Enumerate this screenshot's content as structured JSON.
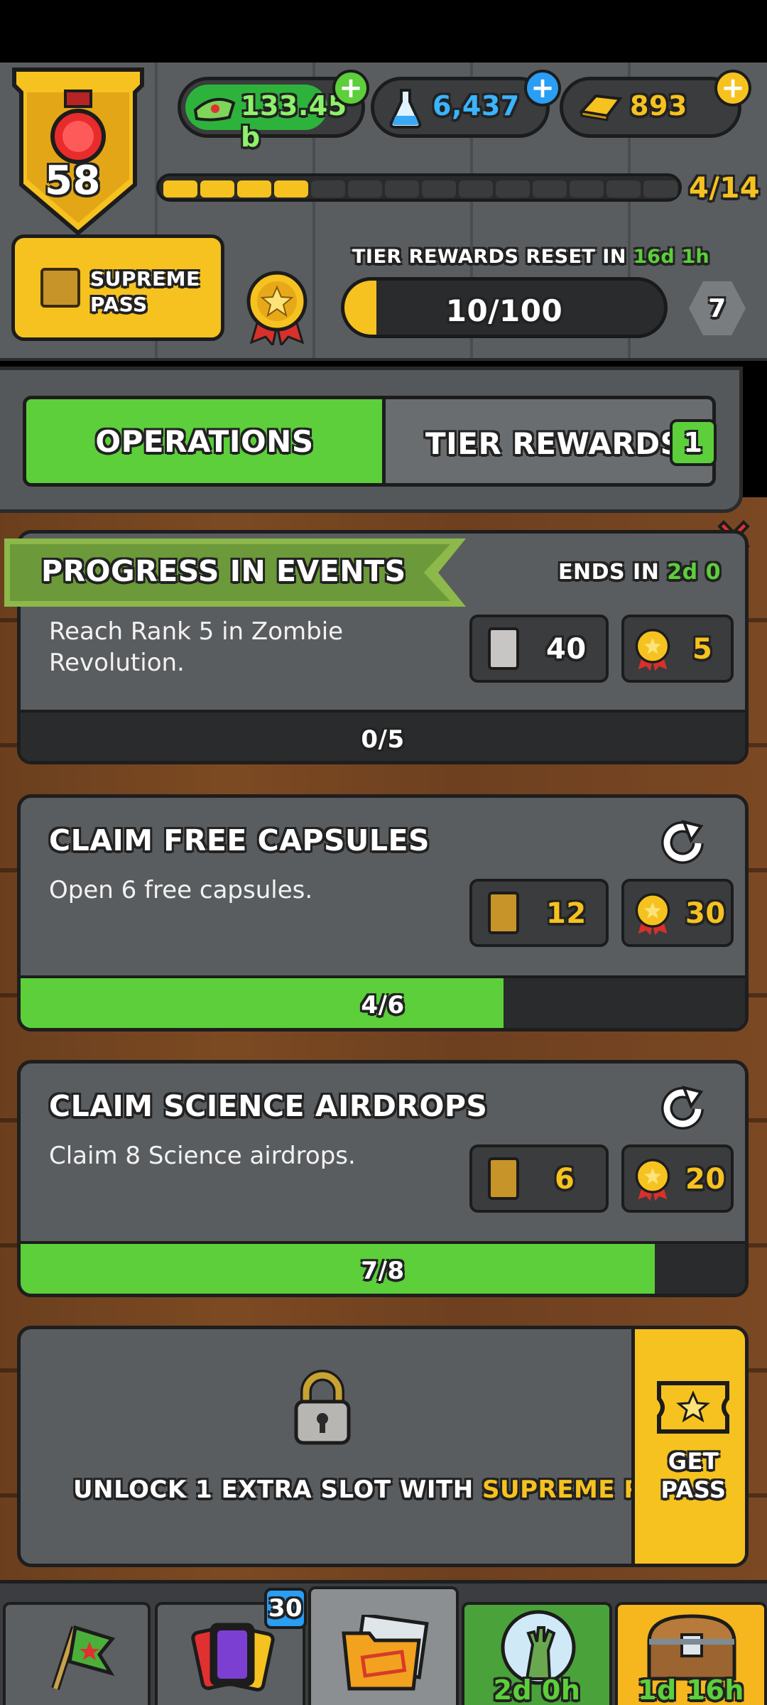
{
  "player": {
    "level": "58",
    "level_progress": "4/14",
    "level_progress_fraction": 0.286
  },
  "currencies": [
    {
      "name": "cash",
      "icon": "cash-icon",
      "value": "133.45 b",
      "plus_color": "#5ccf3b"
    },
    {
      "name": "science",
      "icon": "flask-icon",
      "value": "6,437",
      "plus_color": "#2a9df4"
    },
    {
      "name": "gold",
      "icon": "gold-bars-icon",
      "value": "893",
      "plus_color": "#f6c21f"
    }
  ],
  "supreme_pass": {
    "label_line1": "SUPREME",
    "label_line2": "PASS"
  },
  "tier": {
    "reset_label": "TIER REWARDS RESET IN",
    "reset_time": "16d 1h",
    "progress": "10/100",
    "progress_fraction": 0.1,
    "tier_number": "7"
  },
  "tabs": {
    "operations": "OPERATIONS",
    "tier_rewards": "TIER REWARDS",
    "tier_rewards_badge": "1"
  },
  "missions": [
    {
      "title": "PROGRESS IN EVENTS",
      "ends_label": "ENDS IN",
      "ends_time": "2d 0",
      "desc_line1": "Reach Rank 5 in Zombie",
      "desc_line2": "Revolution.",
      "reward_card_icon": "silver-card-icon",
      "reward_cards": "40",
      "reward_medal": "5",
      "progress": "0/5",
      "progress_fraction": 0
    },
    {
      "title": "CLAIM FREE CAPSULES",
      "desc_line1": "Open 6 free capsules.",
      "reward_card_icon": "gold-card-icon",
      "reward_cards": "12",
      "reward_medal": "30",
      "progress": "4/6",
      "progress_fraction": 0.667
    },
    {
      "title": "CLAIM SCIENCE AIRDROPS",
      "desc_line1": "Claim 8 Science airdrops.",
      "reward_card_icon": "gold-card-icon",
      "reward_cards": "6",
      "reward_medal": "20",
      "progress": "7/8",
      "progress_fraction": 0.875
    }
  ],
  "locked_slot": {
    "text": "UNLOCK 1 EXTRA SLOT WITH",
    "highlight": "SUPREME PASS",
    "get_pass_line1": "GET",
    "get_pass_line2": "PASS"
  },
  "bottom_nav": {
    "cards_badge": "30",
    "event_timer": "2d 0h",
    "chest_timer": "1d 16h"
  },
  "colors": {
    "accent_green": "#5ccf3b",
    "accent_yellow": "#f6c21f",
    "panel_gray": "#5a5d60"
  }
}
